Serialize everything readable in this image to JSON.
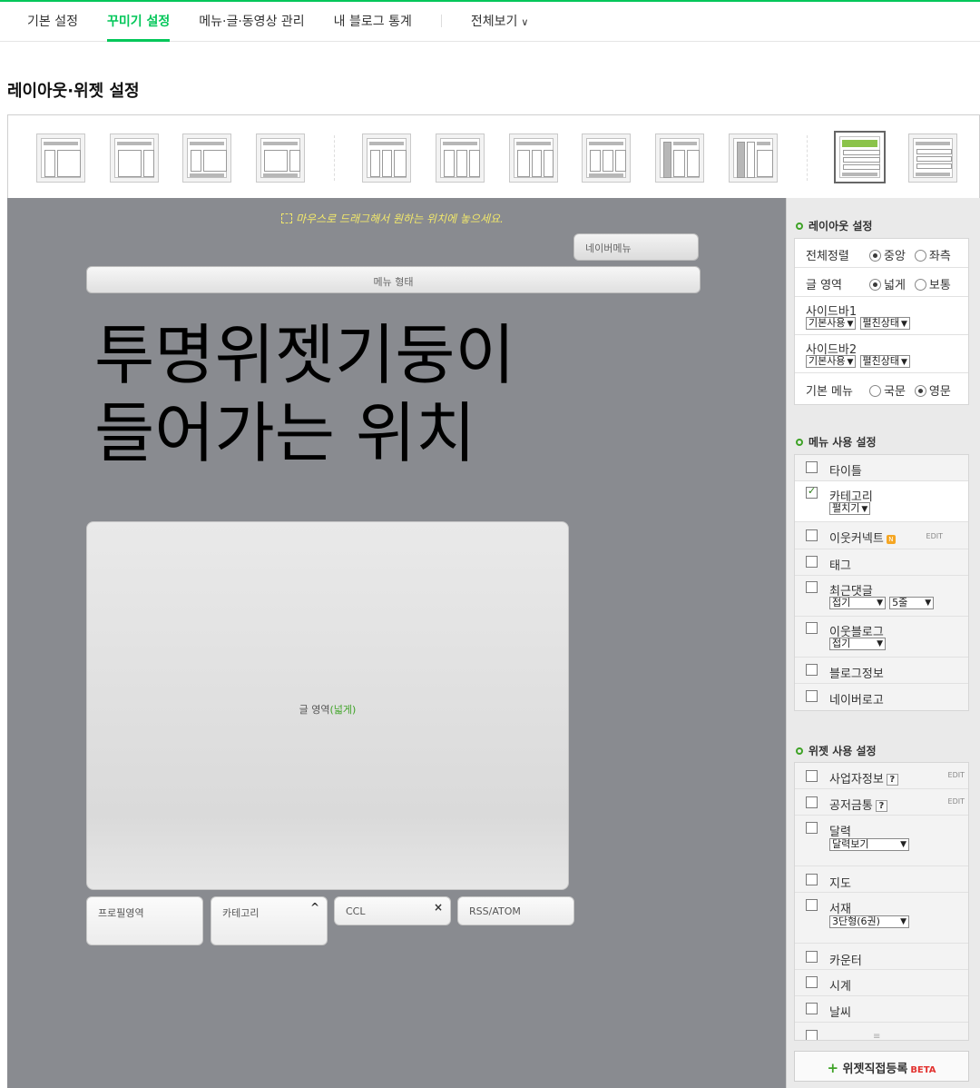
{
  "nav": {
    "tabs": [
      "기본 설정",
      "꾸미기 설정",
      "메뉴·글·동영상 관리",
      "내 블로그 통계"
    ],
    "view_all": "전체보기"
  },
  "page_title": "레이아웃·위젯 설정",
  "canvas": {
    "hint": "마우스로 드래그해서 원하는 위치에 놓으세요.",
    "naver_menu": "네이버메뉴",
    "menu_form": "메뉴 형태",
    "overlay_line1": "투명위젯기둥이",
    "overlay_line2": "들어가는 위치",
    "writing_area": "글 영역",
    "writing_area_mode": "(넓게)",
    "bottom_widgets": [
      "프로필영역",
      "카테고리",
      "CCL",
      "RSS/ATOM"
    ]
  },
  "layout_settings": {
    "title": "레이아웃 설정",
    "align_label": "전체정렬",
    "align_opts": [
      "중앙",
      "좌측"
    ],
    "writing_label": "글 영역",
    "writing_opts": [
      "넓게",
      "보통"
    ],
    "sidebar1": "사이드바1",
    "sidebar2": "사이드바2",
    "sidebar_use": "기본사용",
    "sidebar_state": "펼친상태",
    "basic_menu_label": "기본 메뉴",
    "menu_lang_opts": [
      "국문",
      "영문"
    ]
  },
  "menu_settings": {
    "title": "메뉴 사용 설정",
    "title_item": "타이틀",
    "category": "카테고리",
    "category_opt": "펼치기",
    "neighbor_connect": "이웃커넥트",
    "badge": "N",
    "edit": "EDIT",
    "tag": "태그",
    "recent_comments": "최근댓글",
    "fold": "접기",
    "lines": "5줄",
    "neighbor_blog": "이웃블로그",
    "blog_info": "블로그정보",
    "naver_logo": "네이버로고"
  },
  "widget_settings": {
    "title": "위젯 사용 설정",
    "business_info": "사업자정보",
    "qmark": "?",
    "copyright": "공저금통",
    "calendar": "달력",
    "calendar_opt": "달력보기",
    "map": "지도",
    "bookshelf": "서재",
    "bookshelf_opt": "3단형(6권)",
    "counter": "카운터",
    "clock": "시계",
    "weather": "날씨",
    "add_button": "위젯직접등록",
    "beta": "BETA"
  },
  "colors": {
    "accent": "#03c75a",
    "canvas": "#898b90",
    "hint": "#f2e86b",
    "green_text": "#3fa327"
  }
}
